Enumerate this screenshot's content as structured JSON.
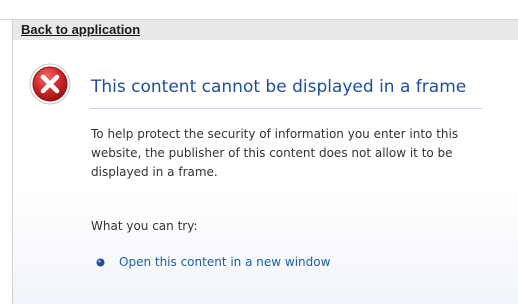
{
  "header": {
    "back_link_label": "Back to application"
  },
  "error": {
    "icon": "error-x-icon",
    "title": "This content cannot be displayed in a frame",
    "description": "To help protect the security of information you enter into this website, the publisher of this content does not allow it to be displayed in a frame.",
    "try_label": "What you can try:",
    "options": [
      {
        "icon": "bullet-icon",
        "label": "Open this content in a new window"
      }
    ]
  },
  "colors": {
    "title": "#1f4e9a",
    "link": "#1f5fa6",
    "error_icon": "#c8202a",
    "panel_bar": "#e9e9e9"
  }
}
